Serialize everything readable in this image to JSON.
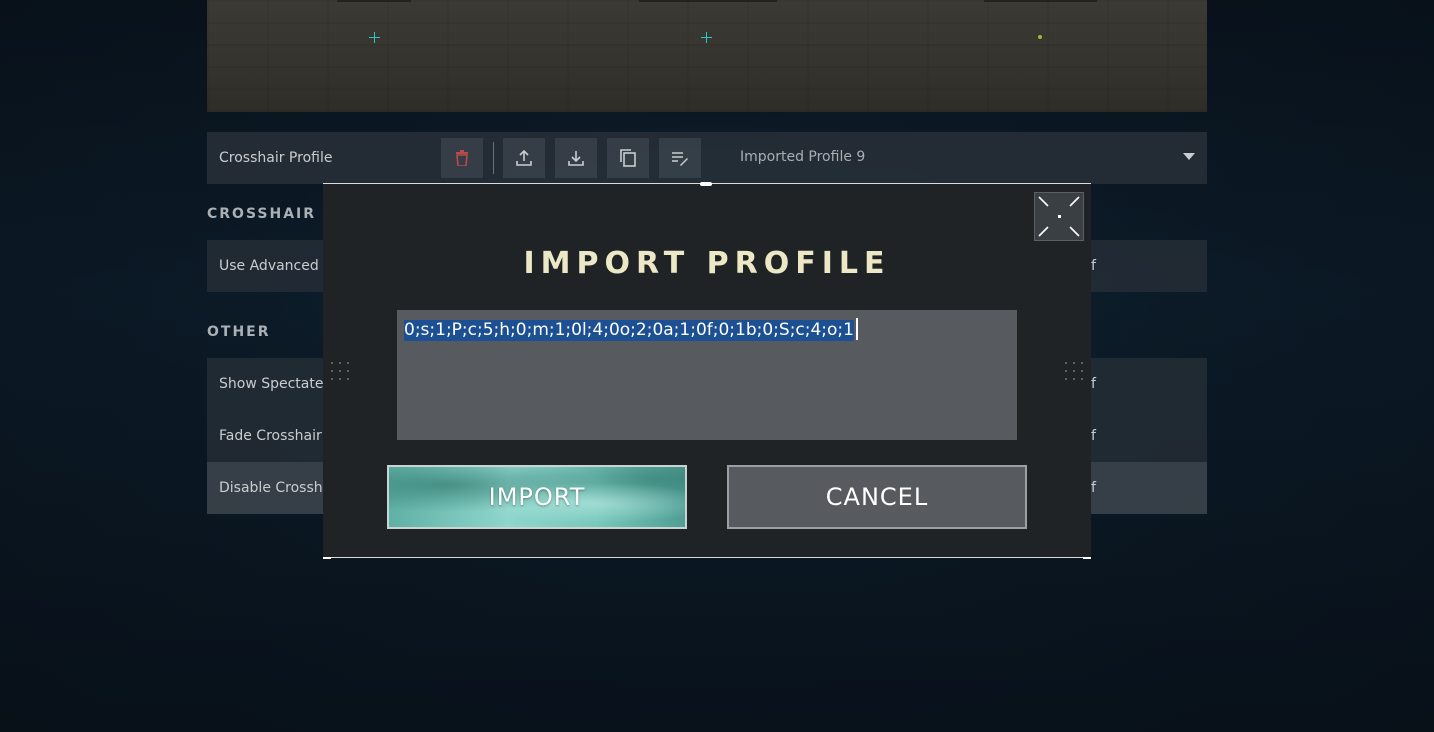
{
  "crosshair_settings": {
    "profile": {
      "label": "Crosshair Profile",
      "selected": "Imported Profile 9",
      "tools": [
        {
          "icon": "trash-icon",
          "color": "#b84a4a"
        },
        {
          "icon": "upload-icon"
        },
        {
          "icon": "download-icon"
        },
        {
          "icon": "copy-icon"
        },
        {
          "icon": "rename-icon"
        }
      ]
    },
    "sections": [
      {
        "heading": "CROSSHAIR",
        "rows": [
          {
            "label": "Use Advanced O",
            "value": "f"
          }
        ]
      },
      {
        "heading": "OTHER",
        "rows": [
          {
            "label": "Show Spectated",
            "value": "f"
          },
          {
            "label": "Fade Crosshair W",
            "value": "f"
          },
          {
            "label": "Disable Crossha",
            "value": "f"
          }
        ]
      }
    ]
  },
  "modal": {
    "title": "IMPORT PROFILE",
    "profile_code": "0;s;1;P;c;5;h;0;m;1;0l;4;0o;2;0a;1;0f;0;1b;0;S;c;4;o;1",
    "import_label": "IMPORT",
    "cancel_label": "CANCEL",
    "exit_icon": "collapse-arrows-icon"
  },
  "colors": {
    "accent_teal": "#7fcfc4",
    "title_cream": "#ece8c6",
    "selection_blue": "#1d4f93",
    "crosshair_cyan": "#2ec4c4",
    "crosshair_dot_green": "#a5b530"
  }
}
